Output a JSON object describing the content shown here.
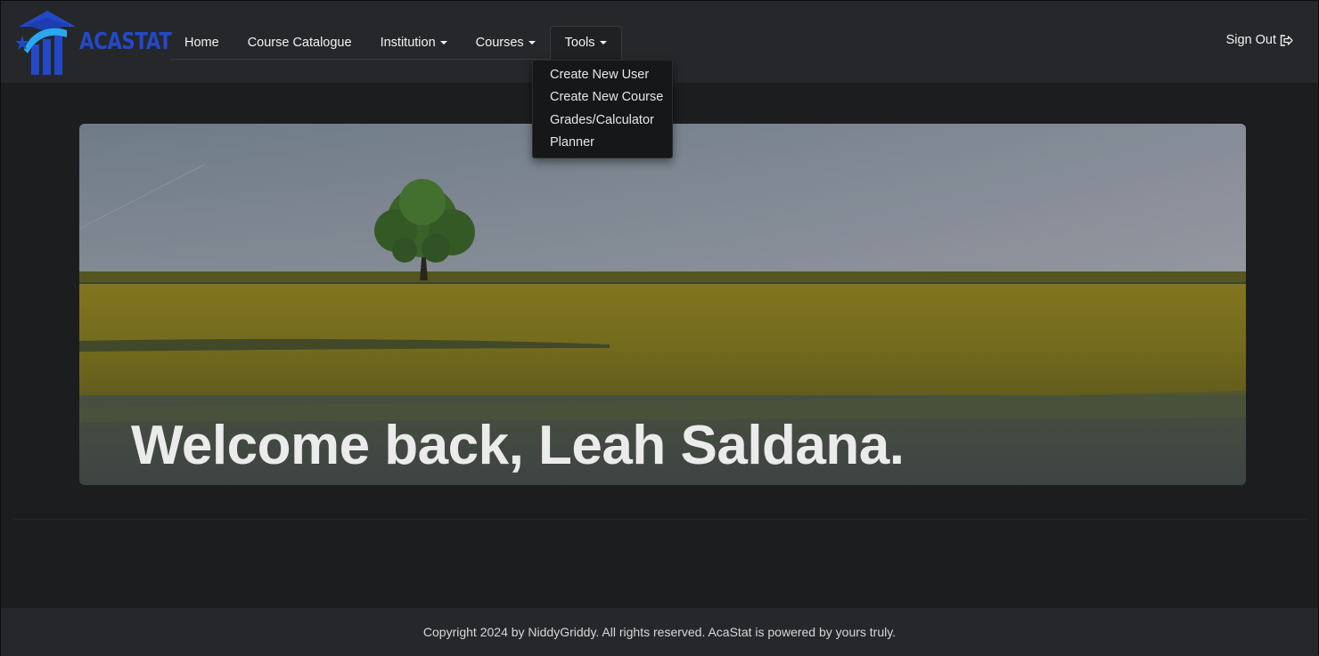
{
  "brand": {
    "name": "ACASTAT",
    "logo_icon": "graduation-building-chart-icon",
    "color": "#2349c8",
    "accent": "#29a8f0"
  },
  "nav": {
    "items": [
      {
        "label": "Home"
      },
      {
        "label": "Course Catalogue"
      },
      {
        "label": "Institution"
      },
      {
        "label": "Courses"
      },
      {
        "label": "Tools"
      }
    ],
    "active": "Tools",
    "signout_label": "Sign Out",
    "signout_icon": "sign-out-icon"
  },
  "tools_menu": {
    "items": [
      {
        "label": "Create New User"
      },
      {
        "label": "Create New Course"
      },
      {
        "label": "Grades/Calculator"
      },
      {
        "label": "Planner"
      }
    ]
  },
  "hero": {
    "title": "Welcome back, Leah Saldana.",
    "image": "field-with-lone-tree"
  },
  "footer": {
    "text": "Copyright 2024 by NiddyGriddy. All rights reserved. AcaStat is powered by yours truly."
  }
}
